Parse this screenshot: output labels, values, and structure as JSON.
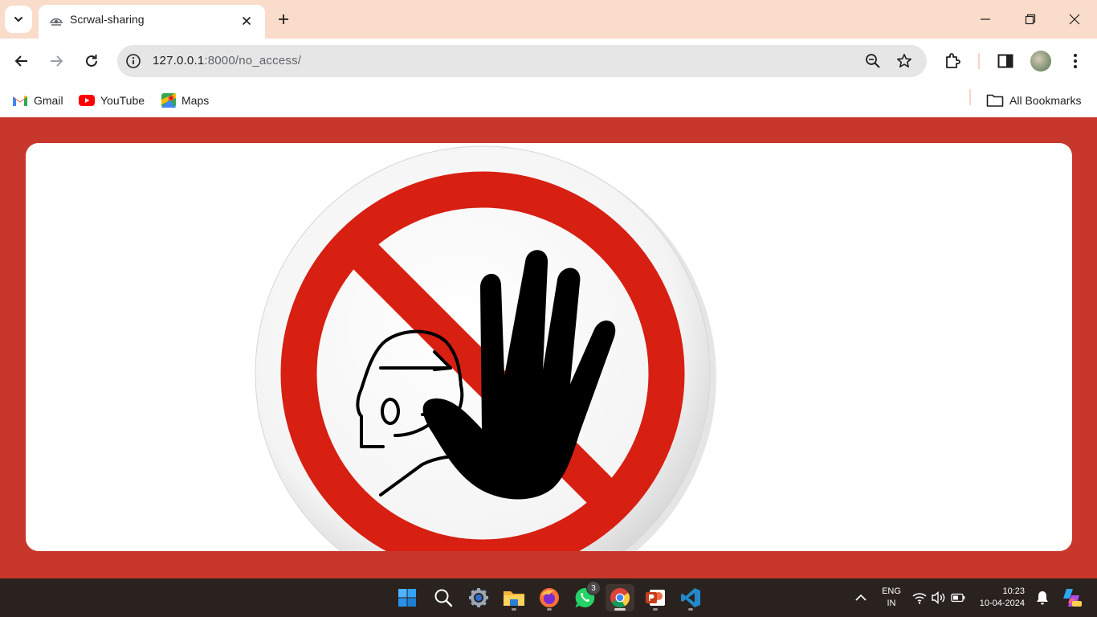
{
  "browser": {
    "tab": {
      "title": "Scrwal-sharing",
      "favicon": "eye-icon"
    },
    "address_bar": {
      "url_host": "127.0.0.1",
      "url_rest": ":8000/no_access/"
    },
    "bookmarks": [
      {
        "label": "Gmail",
        "icon": "gmail-icon"
      },
      {
        "label": "YouTube",
        "icon": "youtube-icon"
      },
      {
        "label": "Maps",
        "icon": "maps-icon"
      }
    ],
    "all_bookmarks_label": "All Bookmarks"
  },
  "page": {
    "background_color": "#c8372c",
    "card_color": "#ffffff",
    "image": "no-access-stop-hand-sign"
  },
  "taskbar": {
    "apps": [
      "windows-start",
      "search",
      "settings",
      "file-explorer",
      "firefox",
      "whatsapp",
      "chrome",
      "powerpoint",
      "vscode"
    ],
    "whatsapp_badge": "3",
    "language": {
      "line1": "ENG",
      "line2": "IN"
    },
    "time": "10:23",
    "date": "10-04-2024"
  }
}
